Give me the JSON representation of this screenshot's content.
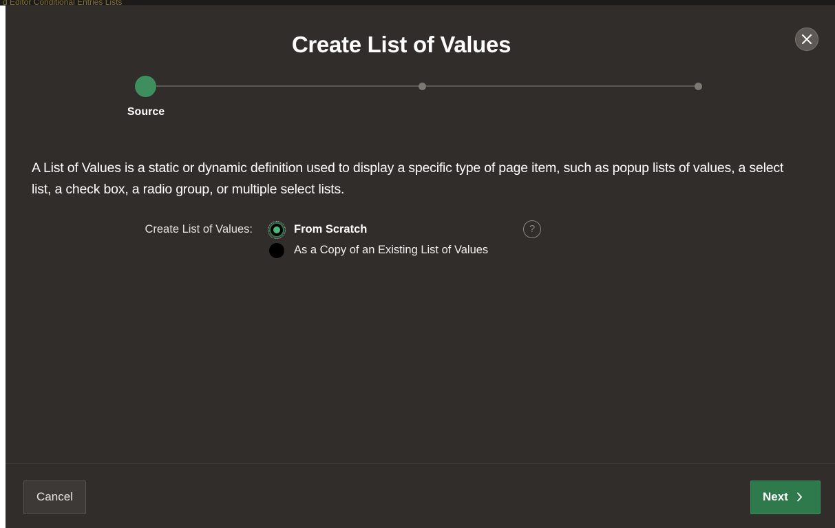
{
  "background": {
    "partial_text": "d Editor    Conditional Entries    Lists"
  },
  "dialog": {
    "title": "Create List of Values",
    "close_icon": "close-icon"
  },
  "wizard": {
    "current_step_label": "Source",
    "total_steps": 3,
    "current_step": 1
  },
  "description": "A List of Values is a static or dynamic definition used to display a specific type of page item, such as popup lists of values, a select list, a check box, a radio group, or multiple select lists.",
  "form": {
    "label": "Create List of Values:",
    "options": [
      {
        "label": "From Scratch",
        "selected": true
      },
      {
        "label": "As a Copy of an Existing List of Values",
        "selected": false
      }
    ],
    "help_icon": "help-icon",
    "help_symbol": "?"
  },
  "footer": {
    "cancel_label": "Cancel",
    "next_label": "Next"
  },
  "colors": {
    "dialog_bg": "#312d2a",
    "accent": "#2f7a4d",
    "step_active": "#3f8f5e"
  }
}
